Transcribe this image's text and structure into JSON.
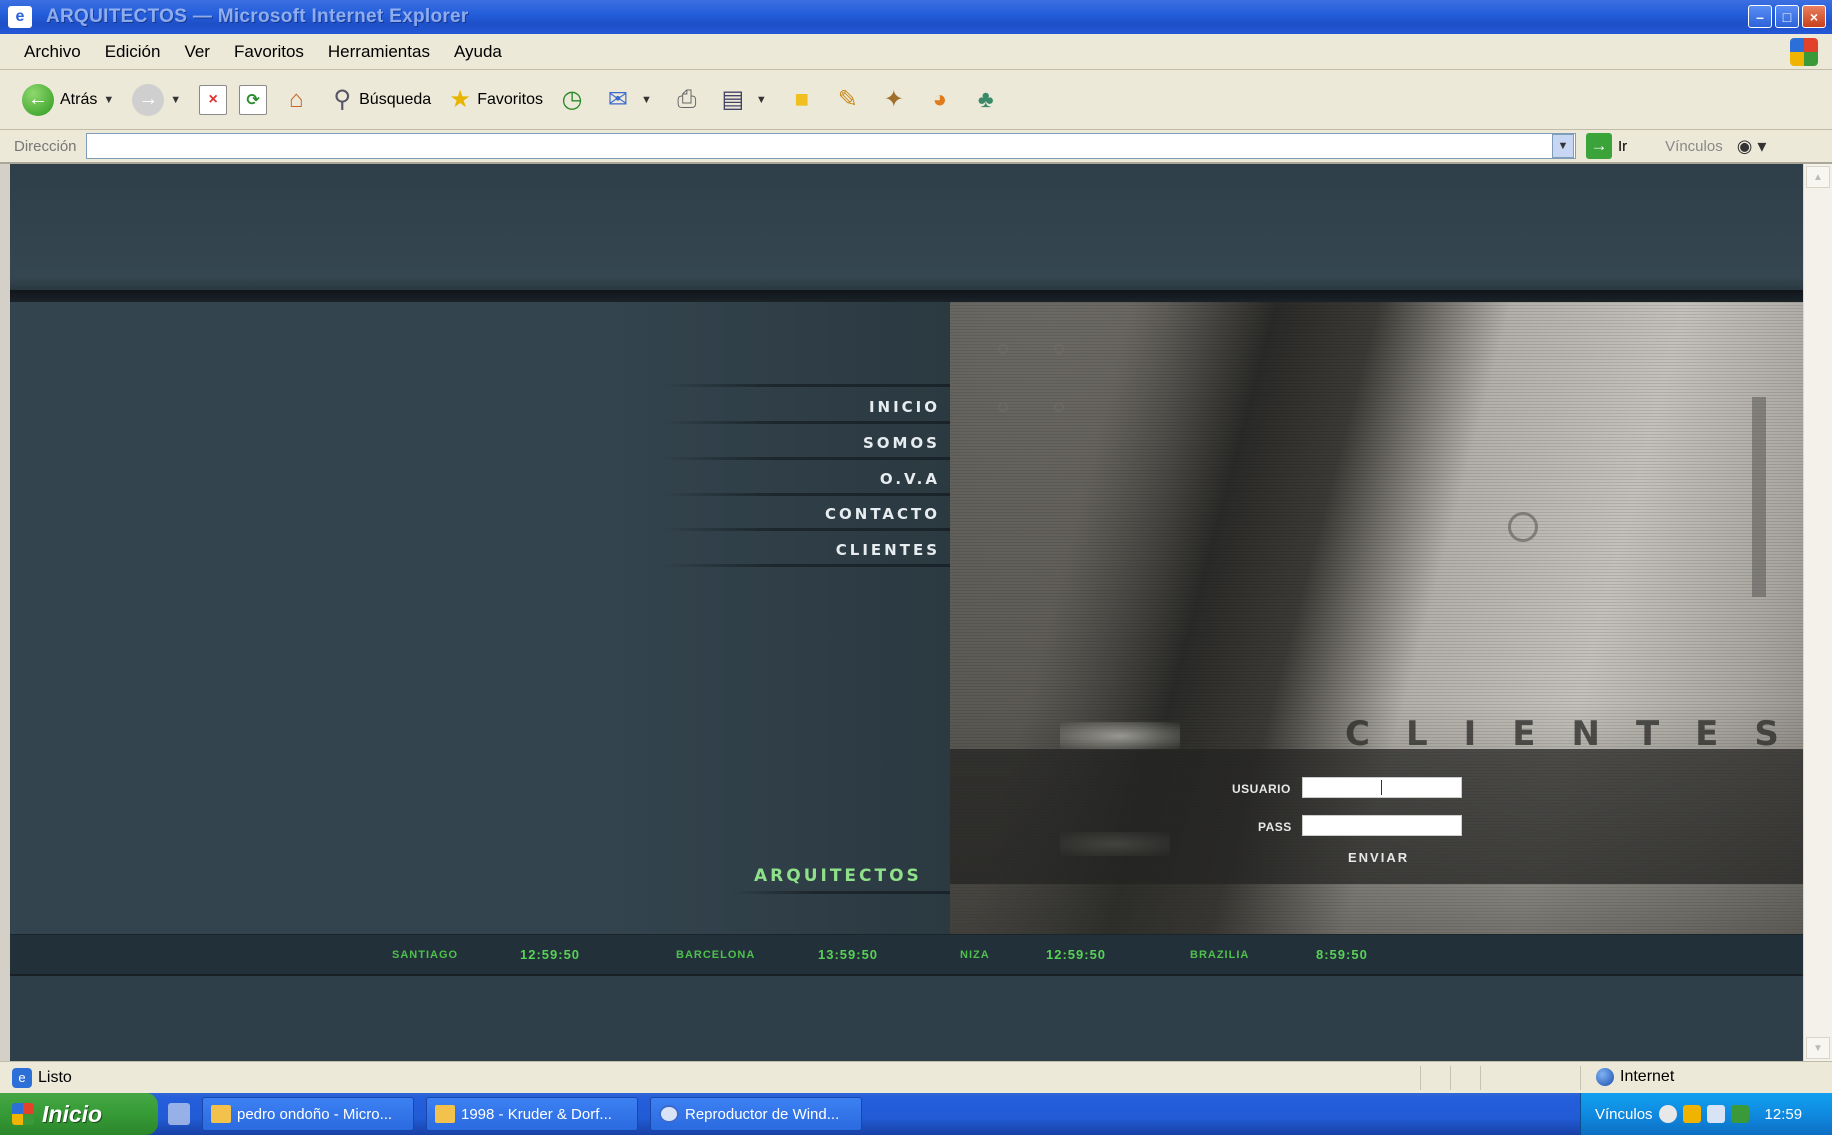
{
  "window": {
    "title": "ARQUITECTOS — Microsoft Internet Explorer",
    "controls": [
      "minimize",
      "maximize",
      "close"
    ]
  },
  "menu": [
    "Archivo",
    "Edición",
    "Ver",
    "Favoritos",
    "Herramientas",
    "Ayuda"
  ],
  "toolbar": {
    "back_label": "Atrás",
    "search_label": "Búsqueda",
    "favorites_label": "Favoritos"
  },
  "address": {
    "label": "Dirección",
    "value": "",
    "go_label": "Ir",
    "links_label": "Vínculos"
  },
  "site": {
    "nav": [
      "INICIO",
      "SOMOS",
      "O.V.A",
      "CONTACTO",
      "CLIENTES"
    ],
    "brand": "ARQUITECTOS",
    "section_title": "CLIENTES",
    "login": {
      "user_label": "USUARIO",
      "pass_label": "PASS",
      "submit_label": "ENVIAR",
      "user_value": "",
      "pass_value": ""
    },
    "clocks": [
      {
        "city": "SANTIAGO",
        "time": "12:59:50"
      },
      {
        "city": "BARCELONA",
        "time": "13:59:50"
      },
      {
        "city": "NIZA",
        "time": "12:59:50"
      },
      {
        "city": "BRAZILIA",
        "time": "8:59:50"
      }
    ],
    "colors": {
      "page_bg": "#2f3f4a",
      "clock_green": "#58d254",
      "nav_text": "#e6ecef"
    }
  },
  "status": {
    "text": "Listo",
    "zone": "Internet"
  },
  "taskbar": {
    "start_label": "Inicio",
    "tasks": [
      "pedro ondoño - Micro...",
      "1998 - Kruder & Dorf...",
      "Reproductor de Wind..."
    ],
    "tray_links": "Vínculos",
    "clock": "12:59"
  }
}
